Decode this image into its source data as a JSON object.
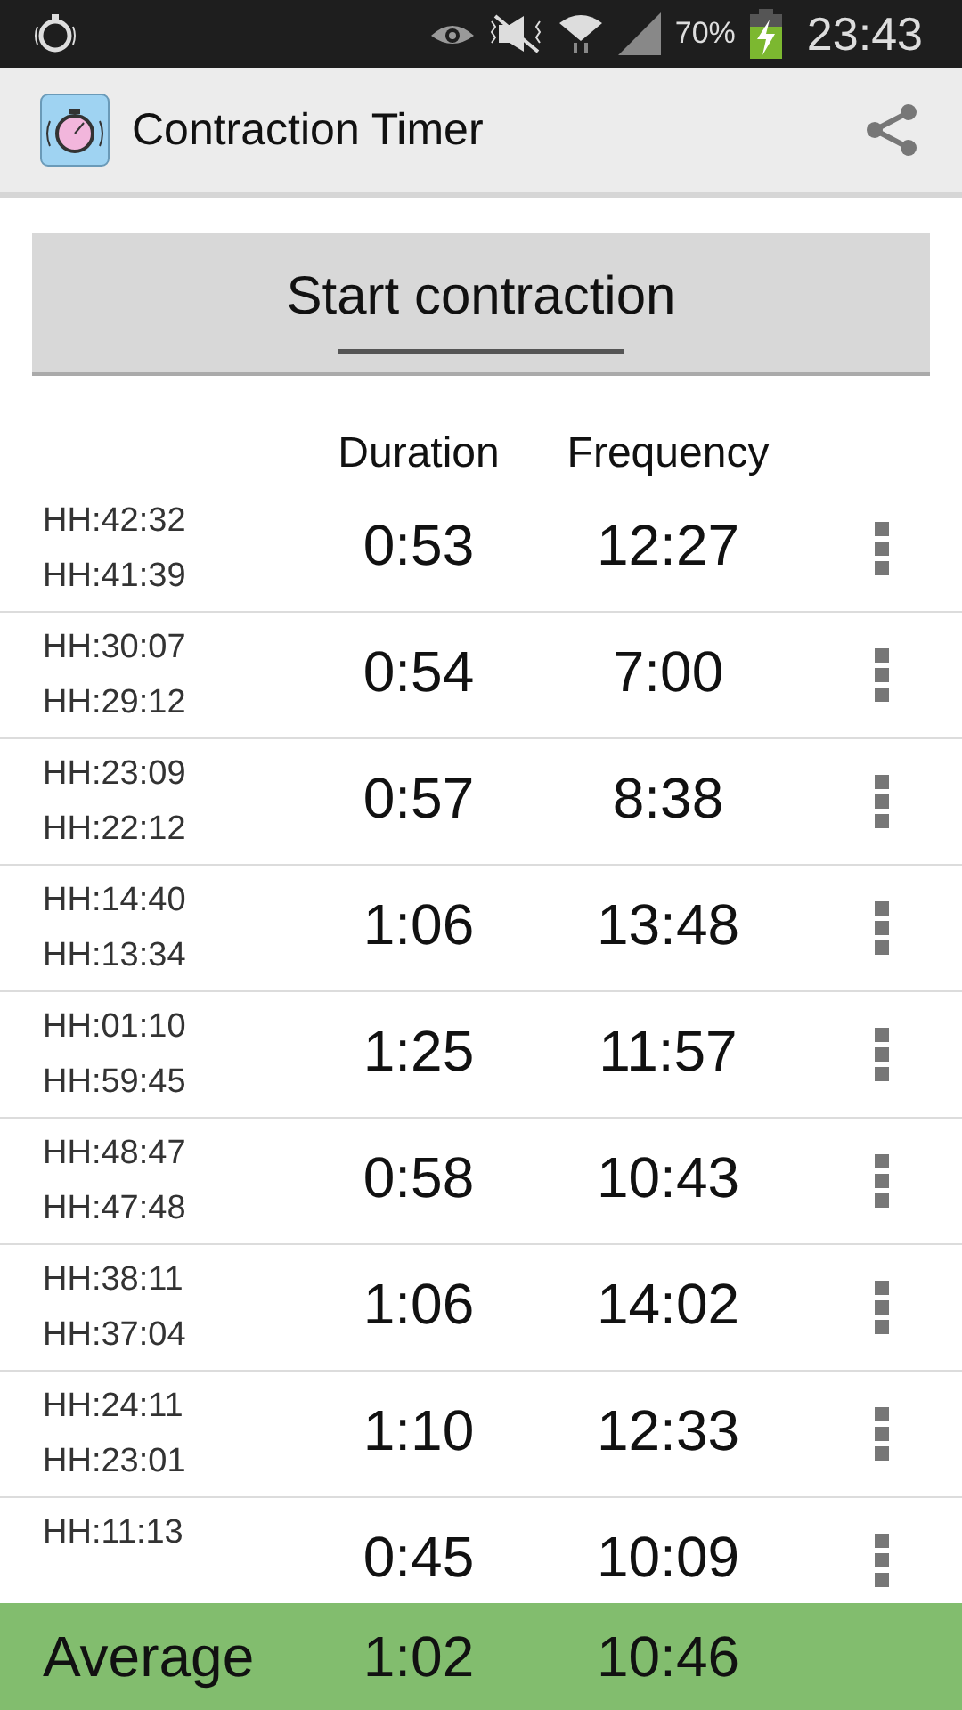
{
  "status_bar": {
    "battery": "70%",
    "time": "23:43"
  },
  "app_bar": {
    "title": "Contraction Timer"
  },
  "start_button": {
    "label": "Start contraction"
  },
  "columns": {
    "duration": "Duration",
    "frequency": "Frequency"
  },
  "contractions": [
    {
      "end": "HH:42:32",
      "start": "HH:41:39",
      "duration": "0:53",
      "frequency": "12:27"
    },
    {
      "end": "HH:30:07",
      "start": "HH:29:12",
      "duration": "0:54",
      "frequency": "7:00"
    },
    {
      "end": "HH:23:09",
      "start": "HH:22:12",
      "duration": "0:57",
      "frequency": "8:38"
    },
    {
      "end": "HH:14:40",
      "start": "HH:13:34",
      "duration": "1:06",
      "frequency": "13:48"
    },
    {
      "end": "HH:01:10",
      "start": "HH:59:45",
      "duration": "1:25",
      "frequency": "11:57"
    },
    {
      "end": "HH:48:47",
      "start": "HH:47:48",
      "duration": "0:58",
      "frequency": "10:43"
    },
    {
      "end": "HH:38:11",
      "start": "HH:37:04",
      "duration": "1:06",
      "frequency": "14:02"
    },
    {
      "end": "HH:24:11",
      "start": "HH:23:01",
      "duration": "1:10",
      "frequency": "12:33"
    },
    {
      "end": "HH:11:13",
      "duration": "0:45",
      "frequency": "10:09"
    }
  ],
  "average": {
    "label": "Average",
    "duration": "1:02",
    "frequency": "10:46"
  }
}
